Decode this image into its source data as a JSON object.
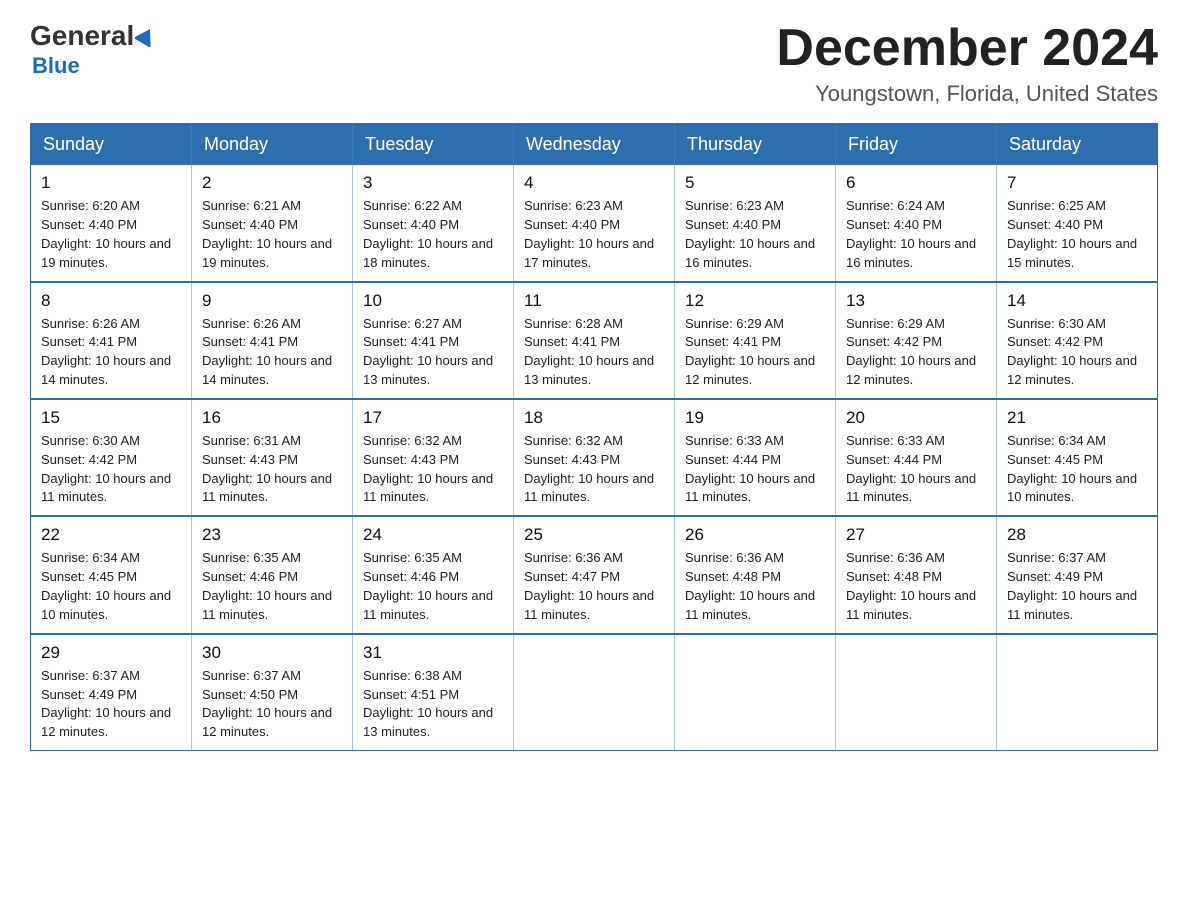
{
  "header": {
    "logo_general": "General",
    "logo_blue": "Blue",
    "month_title": "December 2024",
    "location": "Youngstown, Florida, United States"
  },
  "days_of_week": [
    "Sunday",
    "Monday",
    "Tuesday",
    "Wednesday",
    "Thursday",
    "Friday",
    "Saturday"
  ],
  "weeks": [
    [
      {
        "day": "1",
        "sunrise": "Sunrise: 6:20 AM",
        "sunset": "Sunset: 4:40 PM",
        "daylight": "Daylight: 10 hours and 19 minutes."
      },
      {
        "day": "2",
        "sunrise": "Sunrise: 6:21 AM",
        "sunset": "Sunset: 4:40 PM",
        "daylight": "Daylight: 10 hours and 19 minutes."
      },
      {
        "day": "3",
        "sunrise": "Sunrise: 6:22 AM",
        "sunset": "Sunset: 4:40 PM",
        "daylight": "Daylight: 10 hours and 18 minutes."
      },
      {
        "day": "4",
        "sunrise": "Sunrise: 6:23 AM",
        "sunset": "Sunset: 4:40 PM",
        "daylight": "Daylight: 10 hours and 17 minutes."
      },
      {
        "day": "5",
        "sunrise": "Sunrise: 6:23 AM",
        "sunset": "Sunset: 4:40 PM",
        "daylight": "Daylight: 10 hours and 16 minutes."
      },
      {
        "day": "6",
        "sunrise": "Sunrise: 6:24 AM",
        "sunset": "Sunset: 4:40 PM",
        "daylight": "Daylight: 10 hours and 16 minutes."
      },
      {
        "day": "7",
        "sunrise": "Sunrise: 6:25 AM",
        "sunset": "Sunset: 4:40 PM",
        "daylight": "Daylight: 10 hours and 15 minutes."
      }
    ],
    [
      {
        "day": "8",
        "sunrise": "Sunrise: 6:26 AM",
        "sunset": "Sunset: 4:41 PM",
        "daylight": "Daylight: 10 hours and 14 minutes."
      },
      {
        "day": "9",
        "sunrise": "Sunrise: 6:26 AM",
        "sunset": "Sunset: 4:41 PM",
        "daylight": "Daylight: 10 hours and 14 minutes."
      },
      {
        "day": "10",
        "sunrise": "Sunrise: 6:27 AM",
        "sunset": "Sunset: 4:41 PM",
        "daylight": "Daylight: 10 hours and 13 minutes."
      },
      {
        "day": "11",
        "sunrise": "Sunrise: 6:28 AM",
        "sunset": "Sunset: 4:41 PM",
        "daylight": "Daylight: 10 hours and 13 minutes."
      },
      {
        "day": "12",
        "sunrise": "Sunrise: 6:29 AM",
        "sunset": "Sunset: 4:41 PM",
        "daylight": "Daylight: 10 hours and 12 minutes."
      },
      {
        "day": "13",
        "sunrise": "Sunrise: 6:29 AM",
        "sunset": "Sunset: 4:42 PM",
        "daylight": "Daylight: 10 hours and 12 minutes."
      },
      {
        "day": "14",
        "sunrise": "Sunrise: 6:30 AM",
        "sunset": "Sunset: 4:42 PM",
        "daylight": "Daylight: 10 hours and 12 minutes."
      }
    ],
    [
      {
        "day": "15",
        "sunrise": "Sunrise: 6:30 AM",
        "sunset": "Sunset: 4:42 PM",
        "daylight": "Daylight: 10 hours and 11 minutes."
      },
      {
        "day": "16",
        "sunrise": "Sunrise: 6:31 AM",
        "sunset": "Sunset: 4:43 PM",
        "daylight": "Daylight: 10 hours and 11 minutes."
      },
      {
        "day": "17",
        "sunrise": "Sunrise: 6:32 AM",
        "sunset": "Sunset: 4:43 PM",
        "daylight": "Daylight: 10 hours and 11 minutes."
      },
      {
        "day": "18",
        "sunrise": "Sunrise: 6:32 AM",
        "sunset": "Sunset: 4:43 PM",
        "daylight": "Daylight: 10 hours and 11 minutes."
      },
      {
        "day": "19",
        "sunrise": "Sunrise: 6:33 AM",
        "sunset": "Sunset: 4:44 PM",
        "daylight": "Daylight: 10 hours and 11 minutes."
      },
      {
        "day": "20",
        "sunrise": "Sunrise: 6:33 AM",
        "sunset": "Sunset: 4:44 PM",
        "daylight": "Daylight: 10 hours and 11 minutes."
      },
      {
        "day": "21",
        "sunrise": "Sunrise: 6:34 AM",
        "sunset": "Sunset: 4:45 PM",
        "daylight": "Daylight: 10 hours and 10 minutes."
      }
    ],
    [
      {
        "day": "22",
        "sunrise": "Sunrise: 6:34 AM",
        "sunset": "Sunset: 4:45 PM",
        "daylight": "Daylight: 10 hours and 10 minutes."
      },
      {
        "day": "23",
        "sunrise": "Sunrise: 6:35 AM",
        "sunset": "Sunset: 4:46 PM",
        "daylight": "Daylight: 10 hours and 11 minutes."
      },
      {
        "day": "24",
        "sunrise": "Sunrise: 6:35 AM",
        "sunset": "Sunset: 4:46 PM",
        "daylight": "Daylight: 10 hours and 11 minutes."
      },
      {
        "day": "25",
        "sunrise": "Sunrise: 6:36 AM",
        "sunset": "Sunset: 4:47 PM",
        "daylight": "Daylight: 10 hours and 11 minutes."
      },
      {
        "day": "26",
        "sunrise": "Sunrise: 6:36 AM",
        "sunset": "Sunset: 4:48 PM",
        "daylight": "Daylight: 10 hours and 11 minutes."
      },
      {
        "day": "27",
        "sunrise": "Sunrise: 6:36 AM",
        "sunset": "Sunset: 4:48 PM",
        "daylight": "Daylight: 10 hours and 11 minutes."
      },
      {
        "day": "28",
        "sunrise": "Sunrise: 6:37 AM",
        "sunset": "Sunset: 4:49 PM",
        "daylight": "Daylight: 10 hours and 11 minutes."
      }
    ],
    [
      {
        "day": "29",
        "sunrise": "Sunrise: 6:37 AM",
        "sunset": "Sunset: 4:49 PM",
        "daylight": "Daylight: 10 hours and 12 minutes."
      },
      {
        "day": "30",
        "sunrise": "Sunrise: 6:37 AM",
        "sunset": "Sunset: 4:50 PM",
        "daylight": "Daylight: 10 hours and 12 minutes."
      },
      {
        "day": "31",
        "sunrise": "Sunrise: 6:38 AM",
        "sunset": "Sunset: 4:51 PM",
        "daylight": "Daylight: 10 hours and 13 minutes."
      },
      {
        "day": "",
        "sunrise": "",
        "sunset": "",
        "daylight": ""
      },
      {
        "day": "",
        "sunrise": "",
        "sunset": "",
        "daylight": ""
      },
      {
        "day": "",
        "sunrise": "",
        "sunset": "",
        "daylight": ""
      },
      {
        "day": "",
        "sunrise": "",
        "sunset": "",
        "daylight": ""
      }
    ]
  ]
}
